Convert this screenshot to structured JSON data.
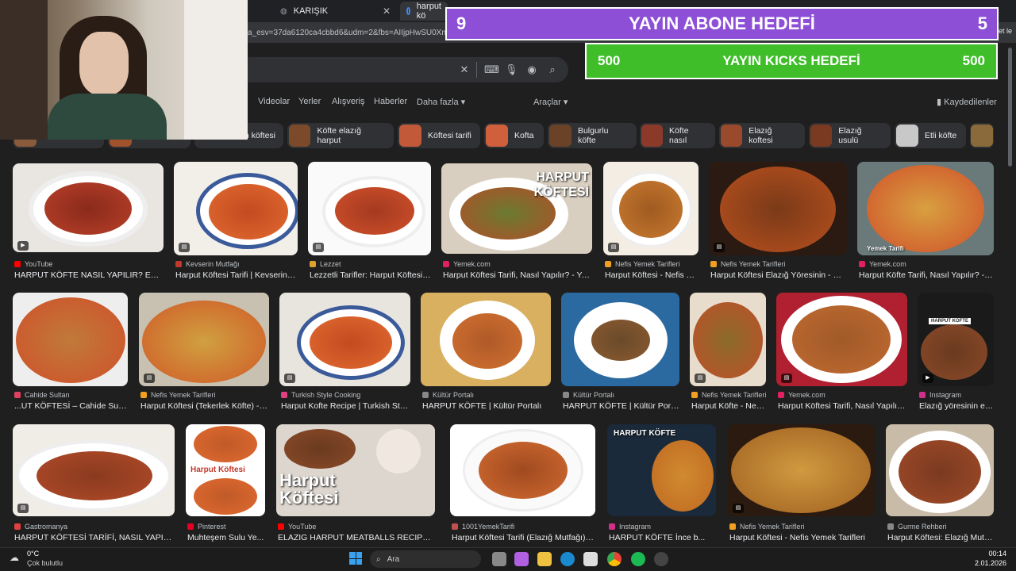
{
  "browser": {
    "tabs": [
      {
        "label": "KARIŞIK"
      },
      {
        "label": "harput kö"
      }
    ],
    "address_fragment": "a_esv=37da6120ca4cbbd6&udm=2&fbs=AIIjpHwSU0Xn4FR",
    "extra_label": "et le"
  },
  "search": {
    "filters": [
      "Videolar",
      "Yerler",
      "Alışveriş",
      "Haberler",
      "Daha fazla ▾"
    ],
    "tools": "Araçlar ▾",
    "saved": "Kaydedilenler"
  },
  "chips": [
    "n köftesi",
    "Köfte elazığ harput",
    "Köftesi tarifi",
    "Kofta",
    "Bulgurlu köfte",
    "Köfte nasıl",
    "Elazığ koftesi",
    "Elazığ usulü",
    "Etli köfte"
  ],
  "results": [
    {
      "source": "YouTube",
      "title": "HARPUT KÖFTE NASIL YAPILIR? ELAZ..."
    },
    {
      "source": "Kevserin Mutfağı",
      "title": "Harput Köftesi Tarifi | Kevserin M..."
    },
    {
      "source": "Lezzet",
      "title": "Lezzetli Tarifler: Harput Köftesi | ..."
    },
    {
      "source": "Yemek.com",
      "title": "Harput Köftesi Tarifi, Nasıl Yapılır? - Yem...",
      "overlay": "HARPUT KÖFTESİ"
    },
    {
      "source": "Nefis Yemek Tarifleri",
      "title": "Harput Köftesi - Nefis Ye..."
    },
    {
      "source": "Nefis Yemek Tarifleri",
      "title": "Harput Köftesi Elazığ Yöresinin - Nef..."
    },
    {
      "source": "Yemek.com",
      "title": "Harput Köfte Tarifi, Nasıl Yapılır? - Y...",
      "overlay": "Yemek Tarifi"
    },
    {
      "source": "Cahide Sultan",
      "title": "...UT KÖFTESİ – Cahide Sultan"
    },
    {
      "source": "Nefis Yemek Tarifleri",
      "title": "Harput Köftesi (Tekerlek Köfte) - N..."
    },
    {
      "source": "Turkish Style Cooking",
      "title": "Harput Kofte Recipe | Turkish Styl..."
    },
    {
      "source": "Kültür Portalı",
      "title": "HARPUT KÖFTE | Kültür Portalı"
    },
    {
      "source": "Kültür Portalı",
      "title": "HARPUT KÖFTE | Kültür Portalı"
    },
    {
      "source": "Nefis Yemek Tarifleri",
      "title": "Harput Köfte - Nefi..."
    },
    {
      "source": "Yemek.com",
      "title": "Harput Köftesi Tarifi, Nasıl Yapılır? ..."
    },
    {
      "source": "Instagram",
      "title": "Elazığ yöresinin ef...",
      "overlay": "HARPUT KÖFTE"
    },
    {
      "source": "Gastromanya",
      "title": "HARPUT KÖFTESİ TARİFİ, NASIL YAPILIR..."
    },
    {
      "source": "Pinterest",
      "title": "Muhteşem Sulu Ye...",
      "overlay": "Harput Köftesi"
    },
    {
      "source": "YouTube",
      "title": "ELAZIG HARPUT MEATBALLS RECIPE | L...",
      "overlay": "Harput Köftesi"
    },
    {
      "source": "1001YemekTarifi",
      "title": "Harput Köftesi Tarifi (Elazığ Mutfağı)-10..."
    },
    {
      "source": "Instagram",
      "title": "HARPUT KÖFTE İnce b...",
      "overlay": "HARPUT KÖFTE"
    },
    {
      "source": "Nefis Yemek Tarifleri",
      "title": "Harput Köftesi - Nefis Yemek Tarifleri"
    },
    {
      "source": "Gurme Rehberi",
      "title": "Harput Köftesi: Elazığ Mutfa..."
    }
  ],
  "goals": {
    "subs": {
      "current": "9",
      "label": "YAYIN ABONE HEDEFİ",
      "target": "5"
    },
    "kicks": {
      "current": "500",
      "label": "YAYIN KICKS HEDEFİ",
      "target": "500"
    }
  },
  "taskbar": {
    "temp": "0°C",
    "weather": "Çok bulutlu",
    "search_placeholder": "Ara",
    "time": "00:14",
    "date": "2.01.2026"
  }
}
